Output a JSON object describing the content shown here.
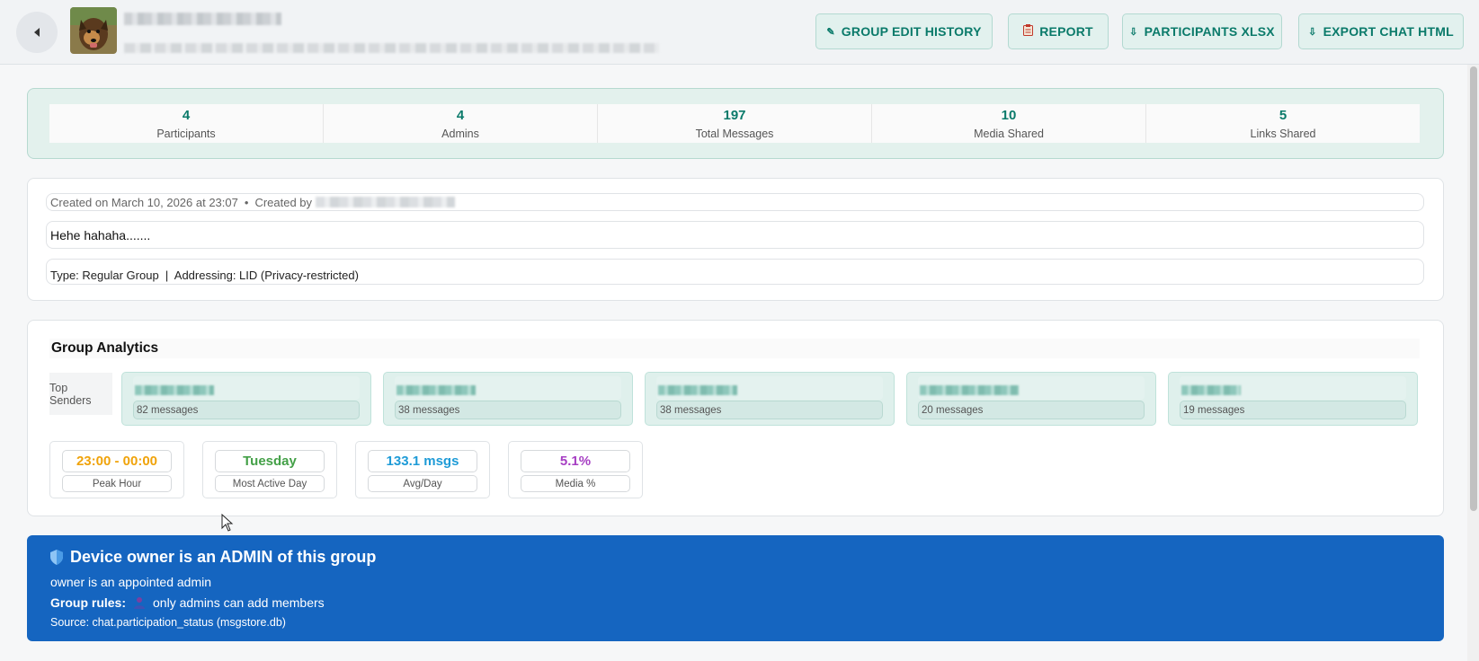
{
  "header": {
    "buttons": {
      "edit_history": "GROUP EDIT HISTORY",
      "report": "REPORT",
      "participants_xlsx": "PARTICIPANTS XLSX",
      "export_chat_html": "EXPORT CHAT HTML"
    },
    "icons": {
      "edit_history": "pencil-icon",
      "report": "clipboard-icon",
      "participants_xlsx": "download-icon",
      "export_chat_html": "download-icon"
    }
  },
  "stats": [
    {
      "value": "4",
      "label": "Participants"
    },
    {
      "value": "4",
      "label": "Admins"
    },
    {
      "value": "197",
      "label": "Total Messages"
    },
    {
      "value": "10",
      "label": "Media Shared"
    },
    {
      "value": "5",
      "label": "Links Shared"
    }
  ],
  "info": {
    "created": "Created on March 10, 2026 at 23:07",
    "separator": "•",
    "created_by_label": "Created by",
    "description": "Hehe hahaha.......",
    "type_line": "Type: Regular Group  |  Addressing: LID (Privacy-restricted)"
  },
  "analytics": {
    "title": "Group Analytics",
    "top_senders_label": "Top Senders",
    "top_senders": [
      {
        "count": "82 messages"
      },
      {
        "count": "38 messages"
      },
      {
        "count": "38 messages"
      },
      {
        "count": "20 messages"
      },
      {
        "count": "19 messages"
      }
    ],
    "metrics": [
      {
        "value": "23:00 - 00:00",
        "label": "Peak Hour",
        "color": "#f0a30a"
      },
      {
        "value": "Tuesday",
        "label": "Most Active Day",
        "color": "#43a047"
      },
      {
        "value": "133.1 msgs",
        "label": "Avg/Day",
        "color": "#1e9bd7"
      },
      {
        "value": "5.1%",
        "label": "Media %",
        "color": "#a63ec3"
      }
    ]
  },
  "admin_banner": {
    "title": "Device owner is an ADMIN of this group",
    "line1": "owner is an appointed admin",
    "rules_label": "Group rules:",
    "rules_text": "only admins can add members",
    "source": "Source: chat.participation_status (msgstore.db)",
    "color": "#1565c0"
  },
  "colors": {
    "accent": "#0a7a6a",
    "accent_bg": "#e3f1ed"
  }
}
